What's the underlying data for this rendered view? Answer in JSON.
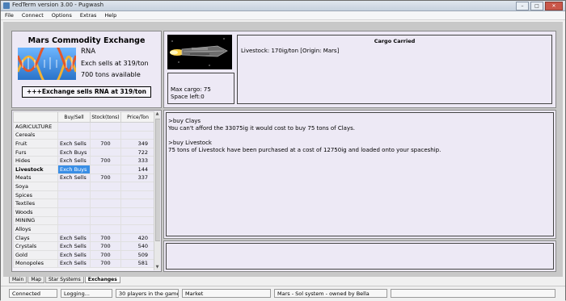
{
  "window": {
    "title": "FedTerm version 3.00 - Pugwash"
  },
  "menu": [
    "File",
    "Connect",
    "Options",
    "Extras",
    "Help"
  ],
  "exchange": {
    "title": "Mars Commodity Exchange",
    "commodity": "RNA",
    "sell_line": "Exch sells at 319/ton",
    "available": "700 tons available",
    "banner": "+++Exchange sells RNA at 319/ton"
  },
  "table": {
    "columns": [
      "",
      "Buy/Sell",
      "Stock(tons)",
      "Price/Ton"
    ],
    "rows": [
      {
        "name": "AGRICULTURE",
        "buysell": "",
        "stock": "",
        "price": ""
      },
      {
        "name": "Cereals",
        "buysell": "",
        "stock": "",
        "price": ""
      },
      {
        "name": "Fruit",
        "buysell": "Exch Sells",
        "stock": "700",
        "price": "349"
      },
      {
        "name": "Furs",
        "buysell": "Exch Buys",
        "stock": "",
        "price": "722"
      },
      {
        "name": "Hides",
        "buysell": "Exch Sells",
        "stock": "700",
        "price": "333"
      },
      {
        "name": "Livestock",
        "buysell": "Exch Buys",
        "stock": "",
        "price": "144",
        "selected": true
      },
      {
        "name": "Meats",
        "buysell": "Exch Sells",
        "stock": "700",
        "price": "337"
      },
      {
        "name": "Soya",
        "buysell": "",
        "stock": "",
        "price": ""
      },
      {
        "name": "Spices",
        "buysell": "",
        "stock": "",
        "price": ""
      },
      {
        "name": "Textiles",
        "buysell": "",
        "stock": "",
        "price": ""
      },
      {
        "name": "Woods",
        "buysell": "",
        "stock": "",
        "price": ""
      },
      {
        "name": "MINING",
        "buysell": "",
        "stock": "",
        "price": ""
      },
      {
        "name": "Alloys",
        "buysell": "",
        "stock": "",
        "price": ""
      },
      {
        "name": "Clays",
        "buysell": "Exch Sells",
        "stock": "700",
        "price": "420"
      },
      {
        "name": "Crystals",
        "buysell": "Exch Sells",
        "stock": "700",
        "price": "540"
      },
      {
        "name": "Gold",
        "buysell": "Exch Sells",
        "stock": "700",
        "price": "509"
      },
      {
        "name": "Monopoles",
        "buysell": "Exch Sells",
        "stock": "700",
        "price": "581"
      }
    ]
  },
  "ship": {
    "max_cargo": "Max cargo: 75",
    "space_left": "Space left:0"
  },
  "cargo": {
    "title": "Cargo Carried",
    "line": "Livestock: 170ig/ton [Origin: Mars]"
  },
  "log": [
    ">buy Clays",
    "You can't afford the 33075ig it would cost to buy 75 tons of Clays.",
    "",
    ">buy Livestock",
    "75 tons of Livestock have been purchased at a cost of 12750ig and loaded onto your spaceship."
  ],
  "tabs": [
    "Main",
    "Map",
    "Star Systems",
    "Exchanges"
  ],
  "status": {
    "connected": "Connected",
    "logging": "Logging...",
    "players": "30 players in the game",
    "location": "Market",
    "system": "Mars - Sol system - owned by Bella"
  }
}
